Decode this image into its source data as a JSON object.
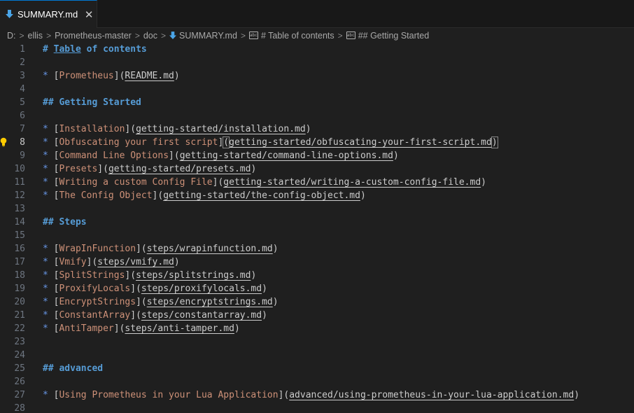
{
  "tab": {
    "title": "SUMMARY.md",
    "close_glyph": "✕"
  },
  "breadcrumb": {
    "items": [
      "D:",
      "ellis",
      "Prometheus-master",
      "doc",
      "SUMMARY.md",
      "# Table of contents",
      "## Getting Started"
    ],
    "separator": ">"
  },
  "editor": {
    "current_line": 8,
    "lines": [
      {
        "n": "1",
        "heading": "# ",
        "heading_link": "Table",
        "heading_rest": " of contents"
      },
      {
        "n": "2"
      },
      {
        "n": "3",
        "bullet": "* ",
        "text": "Prometheus",
        "url": "README.md"
      },
      {
        "n": "4"
      },
      {
        "n": "5",
        "heading": "## Getting Started"
      },
      {
        "n": "6"
      },
      {
        "n": "7",
        "bullet": "* ",
        "text": "Installation",
        "url": "getting-started/installation.md"
      },
      {
        "n": "8",
        "bullet": "* ",
        "text": "Obfuscating your first script",
        "url": "getting-started/obfuscating-your-first-script.md"
      },
      {
        "n": "9",
        "bullet": "* ",
        "text": "Command Line Options",
        "url": "getting-started/command-line-options.md"
      },
      {
        "n": "10",
        "bullet": "* ",
        "text": "Presets",
        "url": "getting-started/presets.md"
      },
      {
        "n": "11",
        "bullet": "* ",
        "text": "Writing a custom Config File",
        "url": "getting-started/writing-a-custom-config-file.md"
      },
      {
        "n": "12",
        "bullet": "* ",
        "text": "The Config Object",
        "url": "getting-started/the-config-object.md"
      },
      {
        "n": "13"
      },
      {
        "n": "14",
        "heading": "## Steps"
      },
      {
        "n": "15"
      },
      {
        "n": "16",
        "bullet": "* ",
        "text": "WrapInFunction",
        "url": "steps/wrapinfunction.md"
      },
      {
        "n": "17",
        "bullet": "* ",
        "text": "Vmify",
        "url": "steps/vmify.md"
      },
      {
        "n": "18",
        "bullet": "* ",
        "text": "SplitStrings",
        "url": "steps/splitstrings.md"
      },
      {
        "n": "19",
        "bullet": "* ",
        "text": "ProxifyLocals",
        "url": "steps/proxifylocals.md"
      },
      {
        "n": "20",
        "bullet": "* ",
        "text": "EncryptStrings",
        "url": "steps/encryptstrings.md"
      },
      {
        "n": "21",
        "bullet": "* ",
        "text": "ConstantArray",
        "url": "steps/constantarray.md"
      },
      {
        "n": "22",
        "bullet": "* ",
        "text": "AntiTamper",
        "url": "steps/anti-tamper.md"
      },
      {
        "n": "23"
      },
      {
        "n": "24"
      },
      {
        "n": "25",
        "heading": "## advanced"
      },
      {
        "n": "26"
      },
      {
        "n": "27",
        "bullet": "* ",
        "text": "Using Prometheus in your Lua Application",
        "url": "advanced/using-prometheus-in-your-lua-application.md"
      },
      {
        "n": "28"
      }
    ]
  },
  "colors": {
    "background": "#1f1f1f",
    "heading": "#569cd6",
    "link_text": "#ce9178",
    "url": "#cccccc",
    "line_number": "#6e7681",
    "accent": "#0078d4",
    "lightbulb": "#ffcc00"
  },
  "icons": {
    "tab": "markdown-file-icon",
    "breadcrumb_file": "markdown-file-icon",
    "breadcrumb_symbol": "symbol-string-icon",
    "gutter": "lightbulb-icon"
  }
}
